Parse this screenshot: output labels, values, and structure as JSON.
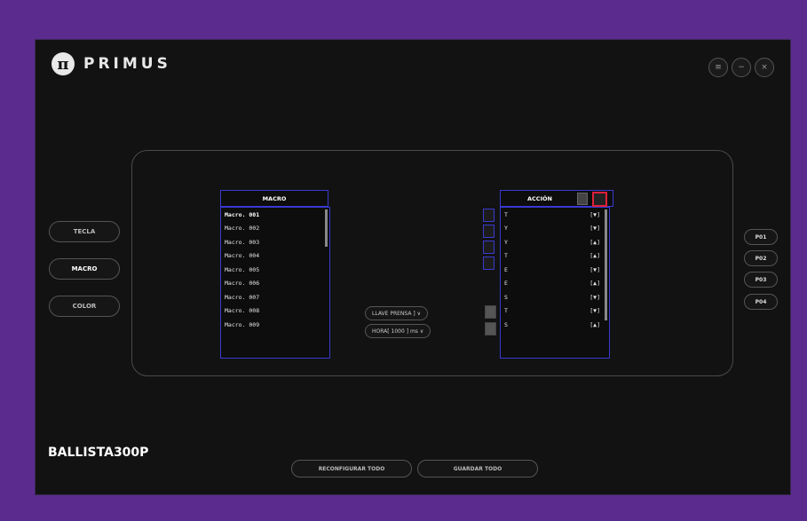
{
  "app": {
    "brand": "PRIMUS",
    "logo_glyph": "π",
    "model": "BALLISTA300P",
    "window_controls": [
      "≡",
      "−",
      "×"
    ]
  },
  "sidebar": {
    "items": [
      {
        "label": "TECLA",
        "active": false
      },
      {
        "label": "MACRO",
        "active": true
      },
      {
        "label": "COLOR",
        "active": false
      }
    ]
  },
  "profiles": [
    "P01",
    "P02",
    "P03",
    "P04"
  ],
  "macro_list": {
    "header": "MACRO",
    "items": [
      "Macro. 001",
      "Macro. 002",
      "Macro. 003",
      "Macro. 004",
      "Macro. 005",
      "Macro. 006",
      "Macro. 007",
      "Macro. 008",
      "Macro. 009"
    ]
  },
  "controls": {
    "key_mode": "LLAVE PRENSA ] ∨",
    "time_mode": "HORA[ 1000 ] ms ∨"
  },
  "action_list": {
    "header": "ACCIÓN",
    "items": [
      {
        "key": "T",
        "dir": "[▼]"
      },
      {
        "key": "Y",
        "dir": "[▼]"
      },
      {
        "key": "Y",
        "dir": "[▲]"
      },
      {
        "key": "T",
        "dir": "[▲]"
      },
      {
        "key": "E",
        "dir": "[▼]"
      },
      {
        "key": "E",
        "dir": "[▲]"
      },
      {
        "key": "S",
        "dir": "[▼]"
      },
      {
        "key": "T",
        "dir": "[▼]"
      },
      {
        "key": "S",
        "dir": "[▲]"
      }
    ]
  },
  "footer": {
    "reset_label": "RECONFIGURAR TODO",
    "save_label": "GUARDAR TODO"
  },
  "colors": {
    "frame": "#5b2b8e",
    "list_border": "#3a3ad0",
    "highlight": "#e0203a"
  }
}
